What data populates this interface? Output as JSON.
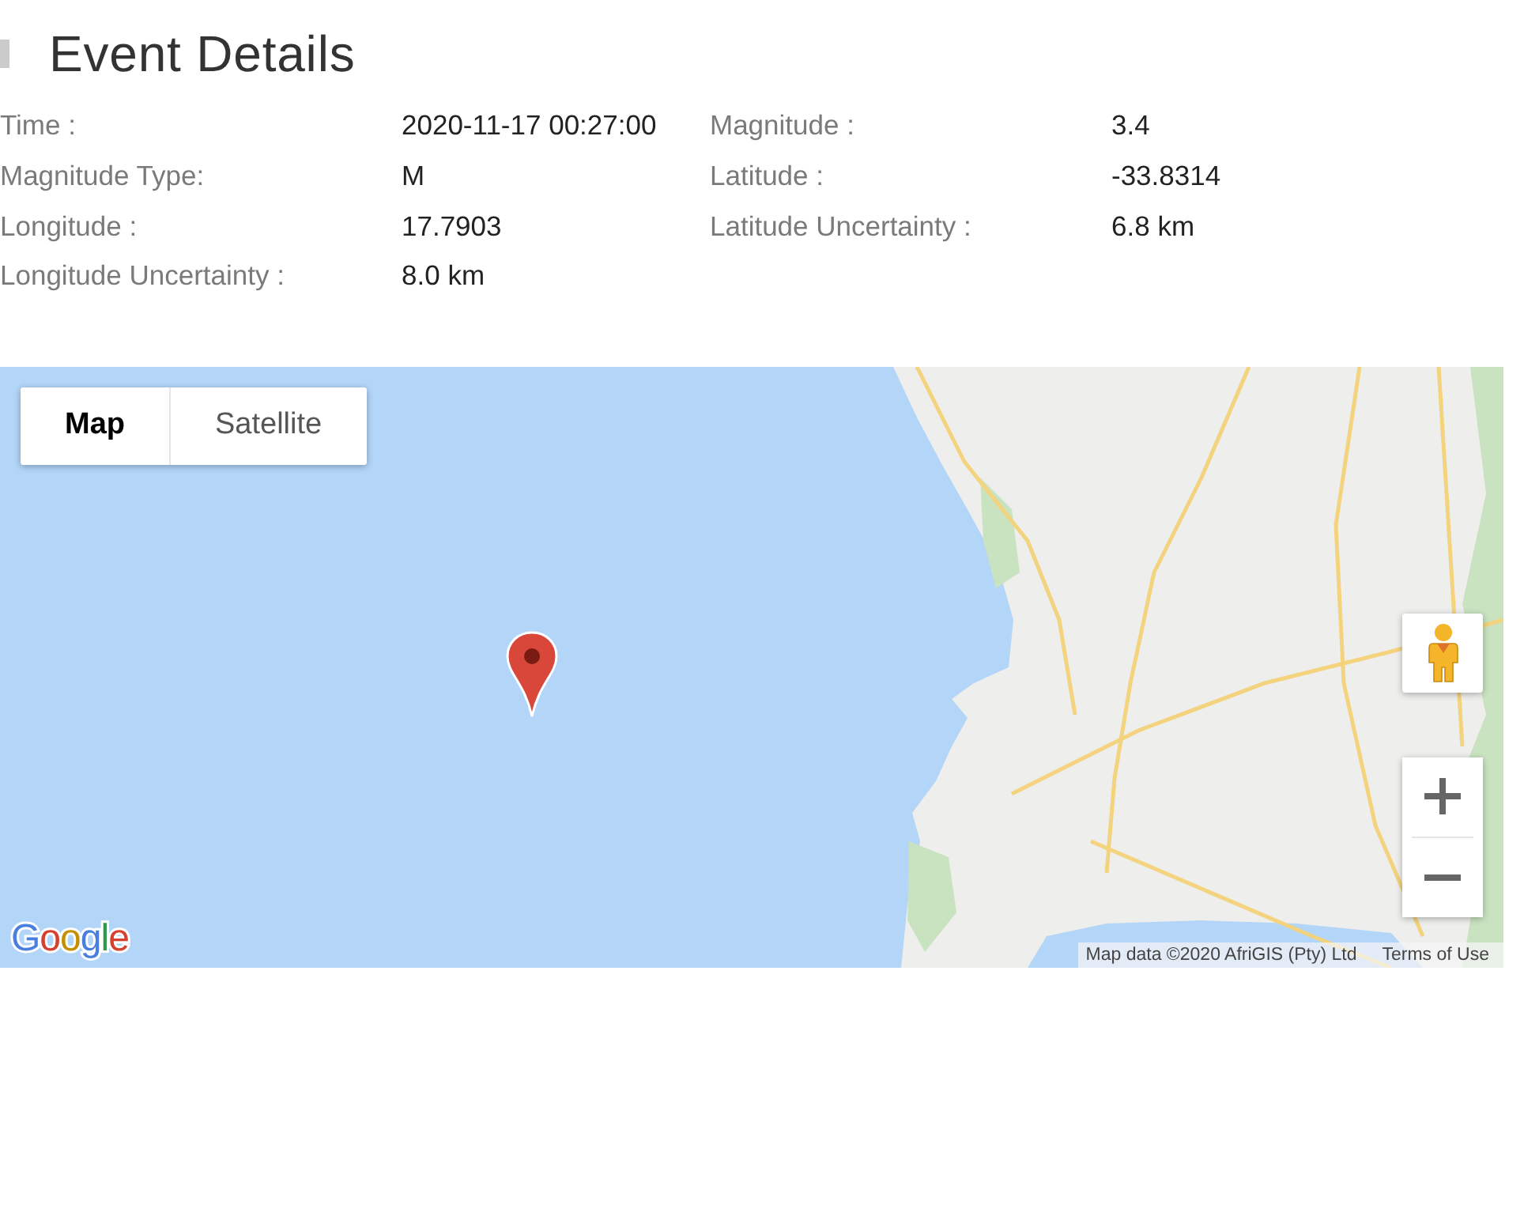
{
  "header": {
    "title": "Event Details"
  },
  "details": [
    {
      "label": "Time :",
      "value": "2020-11-17 00:27:00"
    },
    {
      "label": "Magnitude :",
      "value": "3.4"
    },
    {
      "label": "Magnitude Type:",
      "value": "M"
    },
    {
      "label": "Latitude :",
      "value": "-33.8314"
    },
    {
      "label": "Longitude :",
      "value": "17.7903"
    },
    {
      "label": "Latitude Uncertainty :",
      "value": "6.8 km"
    },
    {
      "label": "Longitude Uncertainty :",
      "value": "8.0 km"
    }
  ],
  "map": {
    "type_tabs": [
      {
        "label": "Map",
        "selected": true
      },
      {
        "label": "Satellite",
        "selected": false
      }
    ],
    "logo": "Google",
    "attribution": "Map data ©2020 AfriGIS (Pty) Ltd",
    "terms_link": "Terms of Use"
  }
}
